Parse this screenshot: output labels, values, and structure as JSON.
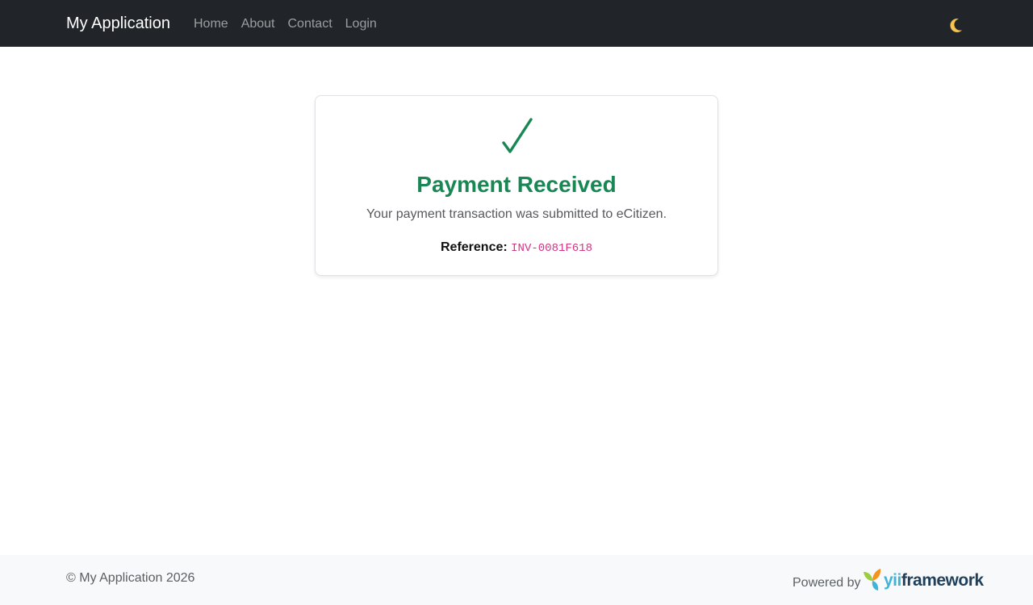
{
  "navbar": {
    "brand": "My Application",
    "links": [
      "Home",
      "About",
      "Contact",
      "Login"
    ],
    "theme_icon": "moon-icon"
  },
  "card": {
    "icon": "check-icon",
    "title": "Payment Received",
    "message": "Your payment transaction was submitted to eCitizen.",
    "reference_label": "Reference:",
    "reference_code": "INV-0081F618",
    "title_color": "#198754",
    "code_color": "#d63384"
  },
  "footer": {
    "copyright": "© My Application 2026",
    "powered_by": "Powered by",
    "logo_text_a": "yii",
    "logo_text_b": "framework"
  }
}
